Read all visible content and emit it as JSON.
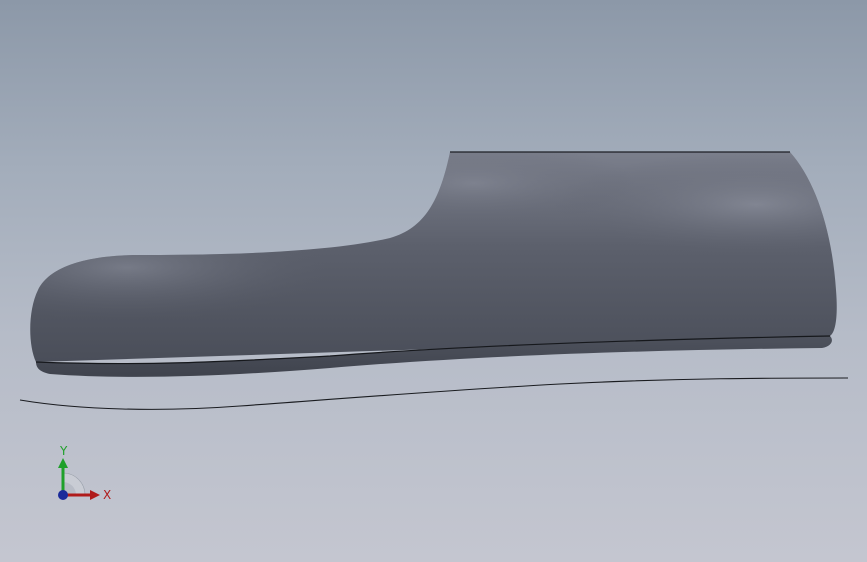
{
  "viewport": {
    "background_top": "#8c98a8",
    "background_bottom": "#c4c6d0",
    "model": {
      "name": "shoe-last-model",
      "color": "#5a5e6b"
    },
    "triad": {
      "x_label": "X",
      "y_label": "Y",
      "x_color": "#b01b1b",
      "y_color": "#1fa02a",
      "z_color": "#1a2a9a"
    }
  }
}
